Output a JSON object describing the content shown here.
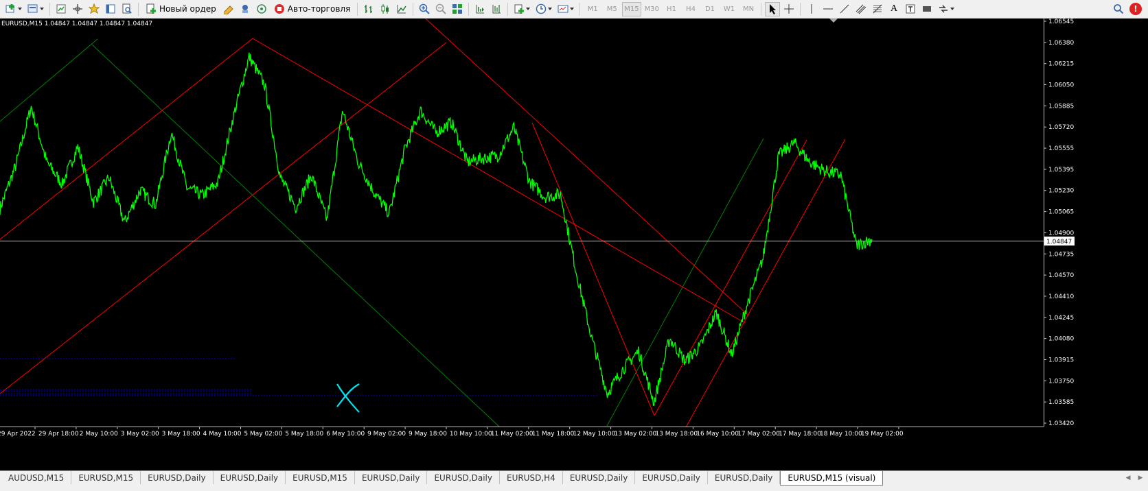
{
  "toolbar": {
    "new_order_label": "Новый ордер",
    "auto_trading_label": "Авто-торговля",
    "timeframes": [
      "M1",
      "M5",
      "M15",
      "M30",
      "H1",
      "H4",
      "D1",
      "W1",
      "MN"
    ],
    "active_timeframe": "M15",
    "text_tool_label": "A",
    "notification_badge": "!"
  },
  "chart": {
    "info_line": "EURUSD,M15  1.04847 1.04847 1.04847 1.04847",
    "current_price_label": "1.04847",
    "price_labels": [
      "1.06545",
      "1.06380",
      "1.06215",
      "1.06050",
      "1.05885",
      "1.05720",
      "1.05555",
      "1.05395",
      "1.05230",
      "1.05065",
      "1.04900",
      "1.04735",
      "1.04570",
      "1.04410",
      "1.04245",
      "1.04080",
      "1.03915",
      "1.03750",
      "1.03585",
      "1.03420"
    ],
    "time_labels": [
      "29 Apr 2022",
      "29 Apr 18:00",
      "2 May 10:00",
      "3 May 02:00",
      "3 May 18:00",
      "4 May 10:00",
      "5 May 02:00",
      "5 May 18:00",
      "6 May 10:00",
      "9 May 02:00",
      "9 May 18:00",
      "10 May 10:00",
      "11 May 02:00",
      "11 May 18:00",
      "12 May 10:00",
      "13 May 02:00",
      "13 May 18:00",
      "16 May 10:00",
      "17 May 02:00",
      "17 May 18:00",
      "18 May 10:00",
      "19 May 02:00"
    ],
    "colors": {
      "background": "#000000",
      "price_line": "#00ff00",
      "trend_lines": "#ff0000",
      "channel_lines": "#008000",
      "current_price": "#c0c0c0",
      "support_levels": "#0000cd",
      "marker": "#00e5ee"
    }
  },
  "chart_data": {
    "type": "line",
    "title": "EURUSD,M15",
    "xlabel": "",
    "ylabel": "",
    "ylim": [
      1.0342,
      1.06545
    ],
    "series": [
      {
        "name": "EURUSD,M15",
        "x": [
          "29 Apr 00:00",
          "29 Apr 06:00",
          "29 Apr 12:00",
          "29 Apr 18:00",
          "2 May 02:00",
          "2 May 08:00",
          "2 May 14:00",
          "2 May 20:00",
          "3 May 02:00",
          "3 May 08:00",
          "3 May 14:00",
          "3 May 20:00",
          "4 May 02:00",
          "4 May 08:00",
          "4 May 14:00",
          "4 May 20:00",
          "5 May 02:00",
          "5 May 08:00",
          "5 May 14:00",
          "5 May 20:00",
          "6 May 02:00",
          "6 May 08:00",
          "6 May 14:00",
          "6 May 20:00",
          "9 May 02:00",
          "9 May 08:00",
          "9 May 14:00",
          "9 May 20:00",
          "10 May 02:00",
          "10 May 08:00",
          "10 May 14:00",
          "10 May 20:00",
          "11 May 02:00",
          "11 May 08:00",
          "11 May 14:00",
          "11 May 20:00",
          "12 May 02:00",
          "12 May 08:00",
          "12 May 14:00",
          "12 May 20:00",
          "13 May 02:00",
          "13 May 08:00",
          "13 May 14:00",
          "13 May 20:00",
          "16 May 02:00",
          "16 May 08:00",
          "16 May 14:00",
          "16 May 20:00",
          "17 May 02:00",
          "17 May 08:00",
          "17 May 14:00",
          "17 May 20:00",
          "18 May 02:00",
          "18 May 08:00",
          "18 May 14:00",
          "18 May 20:00",
          "19 May 02:00"
        ],
        "values": [
          1.0509,
          1.0542,
          1.0588,
          1.0545,
          1.0528,
          1.0557,
          1.0514,
          1.0533,
          1.0498,
          1.0523,
          1.0512,
          1.0568,
          1.0525,
          1.0519,
          1.0529,
          1.0581,
          1.0627,
          1.0605,
          1.0533,
          1.051,
          1.0535,
          1.05,
          1.0585,
          1.0545,
          1.0522,
          1.0505,
          1.0555,
          1.0585,
          1.0568,
          1.0576,
          1.0545,
          1.0548,
          1.055,
          1.0572,
          1.053,
          1.0518,
          1.052,
          1.046,
          1.0408,
          1.0365,
          1.0384,
          1.0398,
          1.0358,
          1.0408,
          1.039,
          1.0402,
          1.0428,
          1.0395,
          1.0435,
          1.047,
          1.055,
          1.056,
          1.0545,
          1.0538,
          1.0535,
          1.048,
          1.0485
        ]
      }
    ]
  },
  "tabs": [
    {
      "label": "AUDUSD,M15",
      "active": false
    },
    {
      "label": "EURUSD,M15",
      "active": false
    },
    {
      "label": "EURUSD,Daily",
      "active": false
    },
    {
      "label": "EURUSD,Daily",
      "active": false
    },
    {
      "label": "EURUSD,M15",
      "active": false
    },
    {
      "label": "EURUSD,Daily",
      "active": false
    },
    {
      "label": "EURUSD,Daily",
      "active": false
    },
    {
      "label": "EURUSD,H4",
      "active": false
    },
    {
      "label": "EURUSD,Daily",
      "active": false
    },
    {
      "label": "EURUSD,Daily",
      "active": false
    },
    {
      "label": "EURUSD,Daily",
      "active": false
    },
    {
      "label": "EURUSD,M15 (visual)",
      "active": true
    }
  ]
}
